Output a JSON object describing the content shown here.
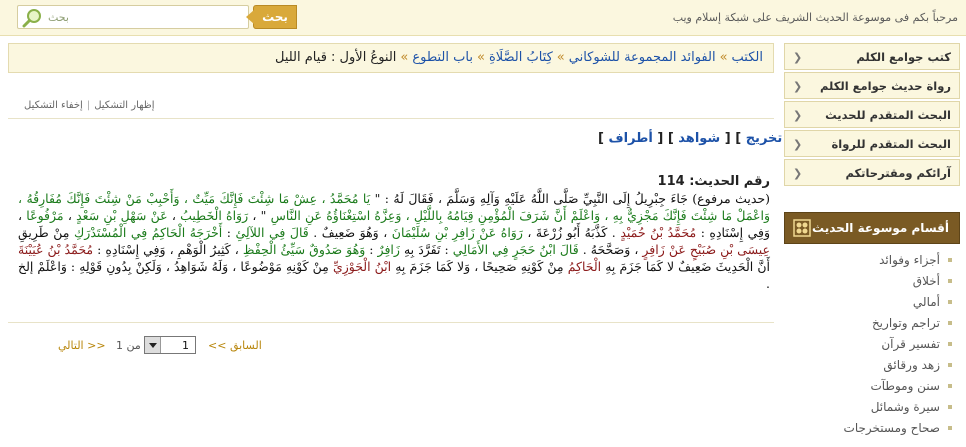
{
  "header": {
    "welcome": "مرحباً بكم فى موسوعة الحديث الشريف على شبكة إسلام ويب",
    "search_button": "بحث",
    "search_placeholder": "بحث",
    "search_icon": "magnifier-icon"
  },
  "breadcrumb": {
    "items": [
      "الكتب",
      "الفوائد المجموعة للشوكاني",
      "كِتَابُ الصَّلَاةِ",
      "باب التطوع"
    ],
    "separator": "»",
    "current": "النوعُ الأول : قيام الليل"
  },
  "toggles": {
    "show": "إظهار التشكيل",
    "hide": "إخفاء التشكيل",
    "separator": "|"
  },
  "refs": {
    "takhreej": "تخريج",
    "shawahid": "شواهد",
    "atraf": "أطراف"
  },
  "hadith": {
    "number_label": "رقم الحديث:",
    "number": "114",
    "segments": [
      {
        "c": "",
        "t": "(حديث مرفوع) "
      },
      {
        "c": "",
        "t": "جَاءَ جِبْرِيلُ إِلَى النَّبِيِّ صَلَّى اللَّهُ عَلَيْهِ وَآلِهِ وَسَلَّمَ ، فَقَالَ لَهُ : \" "
      },
      {
        "c": "g",
        "t": "يَا مُحَمَّدُ ، عِشْ مَا شِئْتَ فَإِنَّكَ مَيِّتٌ ، وَأَحْبِبْ مَنْ شِئْتَ فَإِنَّكَ مُفَارِقُهُ ، وَاعْمَلْ مَا شِئْتَ فَإِنَّكَ مَجْزِيٌّ بِهِ ، وَاعْلَمْ أَنَّ شَرَفَ الْمُؤْمِنِ قِيَامُهُ بِاللَّيْلِ ، وَعِزَّهُ اسْتِغْنَاؤُهُ عَنِ النَّاسِ"
      },
      {
        "c": "",
        "t": " \" ، "
      },
      {
        "c": "g",
        "t": "رَوَاهُ الْخَطِيبُ"
      },
      {
        "c": "",
        "t": " ، "
      },
      {
        "c": "g",
        "t": "عَنْ سَهْلِ بْنِ سَعْدٍ"
      },
      {
        "c": "",
        "t": " ، "
      },
      {
        "c": "g",
        "t": "مَرْفُوعًا"
      },
      {
        "c": "",
        "t": " ، وَفِي إِسْنَادِهِ : "
      },
      {
        "c": "r",
        "t": "مُحَمَّدُ بْنُ حُمَيْدٍ"
      },
      {
        "c": "",
        "t": " . كَذَّبَهُ أَبُو زُرْعَةَ ، "
      },
      {
        "c": "g",
        "t": "رَوَاهُ عَنْ زَافِرِ بْنِ سُلَيْمَانَ"
      },
      {
        "c": "",
        "t": " ، وَهُوَ ضَعِيفٌ . "
      },
      {
        "c": "g",
        "t": "قَالَ فِي اللآلِئِ"
      },
      {
        "c": "",
        "t": " : "
      },
      {
        "c": "g",
        "t": "أَخْرَجَهُ الْحَاكِمُ فِي الْمُسْتَدْرَكِ"
      },
      {
        "c": "",
        "t": " مِنْ طَرِيقِ "
      },
      {
        "c": "r",
        "t": "عِيسَى بْنِ صُبَيْحٍ عَنْ زَافِرٍ"
      },
      {
        "c": "",
        "t": " ، وَصَحَّحَهُ . "
      },
      {
        "c": "g",
        "t": "قَالَ ابْنُ حَجَرٍ فِي الأَمَالِي"
      },
      {
        "c": "",
        "t": " : تَفَرَّدَ بِهِ "
      },
      {
        "c": "g",
        "t": "زَافِرٌ"
      },
      {
        "c": "",
        "t": " : "
      },
      {
        "c": "g",
        "t": "وَهُوَ صَدُوقٌ سَيِّئُ الْحِفْظِ"
      },
      {
        "c": "",
        "t": " ، كَثِيرُ الْوَهْمِ ، وَفِي إِسْنَادِهِ : "
      },
      {
        "c": "r",
        "t": "مُحَمَّدُ بْنُ عُيَيْنَةَ"
      },
      {
        "c": "",
        "t": " أَنَّ الْحَدِيثَ ضَعِيفٌ لا كَمَا جَزَمَ بِهِ "
      },
      {
        "c": "r",
        "t": "الْحَاكِمُ"
      },
      {
        "c": "",
        "t": " مِنْ كَوْنِهِ صَحِيحًا ، وَلا كَمَا جَزَمَ بِهِ "
      },
      {
        "c": "r",
        "t": "ابْنُ الْجَوْزِيِّ"
      },
      {
        "c": "",
        "t": " مِنْ كَوْنِهِ مَوْضُوعًا ، وَلَهُ شَوَاهِدُ ، وَلَكِنْ بِدُونِ قَوْلِهِ : وَاعْلَمْ إلخ ."
      }
    ]
  },
  "pager": {
    "next": "التالي >>",
    "of": "من",
    "total": "1",
    "page": "1",
    "prev": "<< السابق"
  },
  "sidebar": {
    "items": [
      "كتب جوامع الكلم",
      "رواة حديث جوامع الكلم",
      "البحث المتقدم للحديث",
      "البحث المتقدم للرواة",
      "آرائكم ومقترحاتكم"
    ],
    "chevron_icon": "chevron-left-icon",
    "section_title": "أقسام موسوعة الحديث",
    "section_icon": "ornament-icon",
    "section_items": [
      "أجزاء وفوائد",
      "أخلاق",
      "أمالي",
      "تراجم وتواريخ",
      "تفسير قرآن",
      "زهد ورقائق",
      "سنن وموطآت",
      "سيرة وشمائل",
      "صحاح ومستخرجات"
    ]
  },
  "colors": {
    "link": "#1d52a8",
    "green": "#1a7a1a",
    "red": "#8b1a1a",
    "accent": "#d9a93a",
    "section": "#7a5a24"
  }
}
